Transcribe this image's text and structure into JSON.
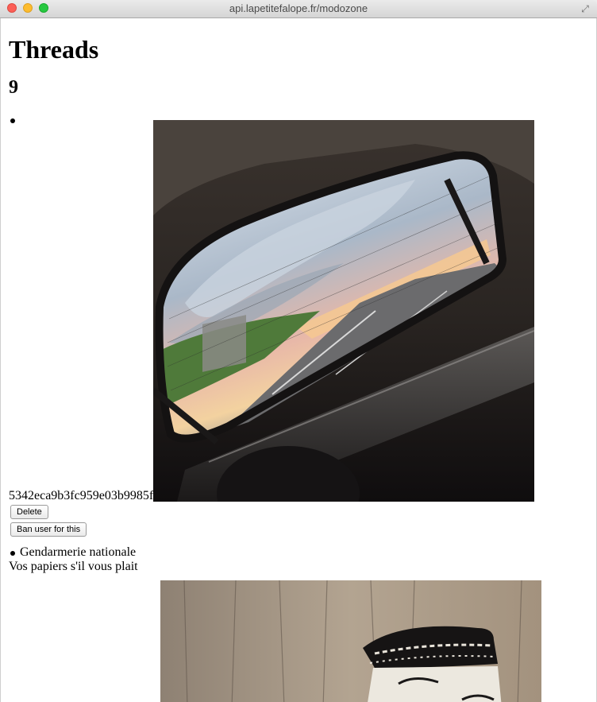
{
  "browser": {
    "url": "api.lapetitefalope.fr/modozone"
  },
  "page": {
    "heading": "Threads",
    "count": "9"
  },
  "threads": [
    {
      "id_text": "5342eca9b3fc959e03b9985f",
      "delete_label": "Delete",
      "ban_label": "Ban user for this"
    },
    {
      "title": "Gendarmerie nationale",
      "text": "Vos papiers s'il vous plait"
    }
  ],
  "colors": {
    "close": "#fc5f57",
    "minimize": "#fdbc2e",
    "maximize": "#27c840"
  }
}
